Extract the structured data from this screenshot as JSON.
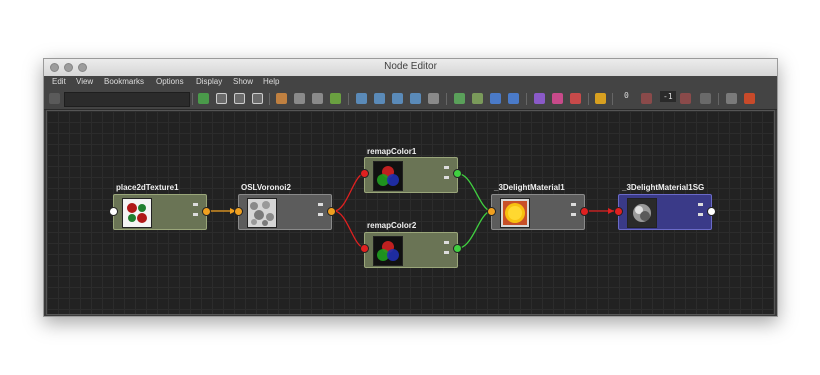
{
  "window": {
    "title": "Node Editor"
  },
  "menu": [
    "Edit",
    "View",
    "Bookmarks",
    "Options",
    "Display",
    "Show",
    "Help"
  ],
  "toolbar": {
    "num_zero": "0",
    "num_minus_one": "-1"
  },
  "nodes": [
    {
      "name": "place2dTexture1",
      "swatch": "checker-texture-icon"
    },
    {
      "name": "OSLVoronoi2",
      "swatch": "noise-texture-icon"
    },
    {
      "name": "remapColor1",
      "swatch": "rgb-remap-icon"
    },
    {
      "name": "remapColor2",
      "swatch": "rgb-remap-icon"
    },
    {
      "name": "_3DelightMaterial1",
      "swatch": "sun-material-icon"
    },
    {
      "name": "_3DelightMaterial1SG",
      "swatch": "shading-group-icon"
    }
  ],
  "colors": {
    "port_output_orange": "#f0a020",
    "port_color_red": "#e02020",
    "port_color_green": "#40d040",
    "port_white": "#ffffff",
    "node_green": "#6a7455",
    "node_gray": "#5c5c5c",
    "node_blue": "#3a3a88"
  }
}
